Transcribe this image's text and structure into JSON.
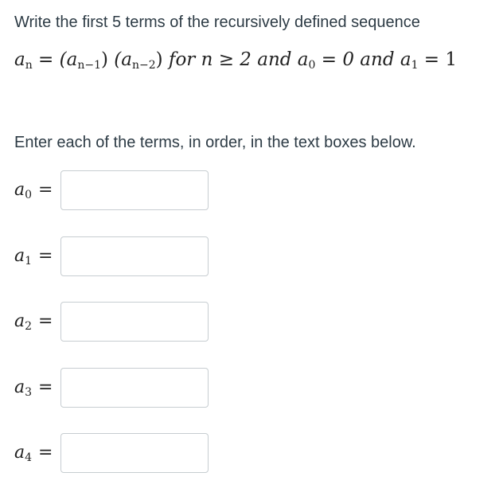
{
  "question": {
    "title": "Write the first 5 terms of the recursively defined sequence",
    "formula": {
      "lhs": "a",
      "lhs_sub": "n",
      "eq": " = ",
      "t1": "(a",
      "t1_sub": "n−1",
      "t1_close": ")",
      "t2": "(a",
      "t2_sub": "n−2",
      "t2_close": ")",
      "cond": " for n ≥ 2 and a",
      "cond_sub": "0",
      "cond_val": " = 0 and a",
      "cond2_sub": "1",
      "cond2_val": " = 1"
    },
    "instruction": "Enter each of the terms, in order, in the text boxes below."
  },
  "answers": [
    {
      "var": "a",
      "sub": "0",
      "eq": "=",
      "value": ""
    },
    {
      "var": "a",
      "sub": "1",
      "eq": "=",
      "value": ""
    },
    {
      "var": "a",
      "sub": "2",
      "eq": "=",
      "value": ""
    },
    {
      "var": "a",
      "sub": "3",
      "eq": "=",
      "value": ""
    },
    {
      "var": "a",
      "sub": "4",
      "eq": "=",
      "value": ""
    }
  ]
}
